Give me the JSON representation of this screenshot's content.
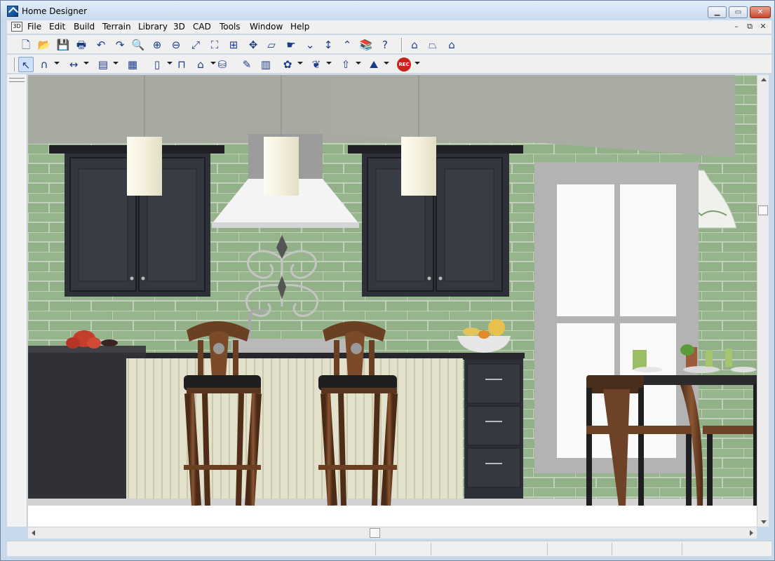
{
  "window": {
    "title": "Home Designer"
  },
  "menu": [
    "File",
    "Edit",
    "Build",
    "Terrain",
    "Library",
    "3D",
    "CAD",
    "Tools",
    "Window",
    "Help"
  ],
  "toolbar1": [
    {
      "name": "new-icon",
      "glyph": "🗋"
    },
    {
      "name": "open-folder-icon",
      "glyph": "📂"
    },
    {
      "name": "save-icon",
      "glyph": "💾"
    },
    {
      "name": "print-icon",
      "glyph": "🖶"
    },
    {
      "name": "undo-icon",
      "glyph": "↶"
    },
    {
      "name": "redo-icon",
      "glyph": "↷"
    },
    {
      "name": "zoom-icon",
      "glyph": "🔍"
    },
    {
      "name": "zoom-in-icon",
      "glyph": "⊕"
    },
    {
      "name": "zoom-out-icon",
      "glyph": "⊖"
    },
    {
      "name": "zoom-box-icon",
      "glyph": "⤢"
    },
    {
      "name": "fill-window-icon",
      "glyph": "⛶"
    },
    {
      "name": "fit-all-icon",
      "glyph": "⊞"
    },
    {
      "name": "pan-icon",
      "glyph": "✥"
    },
    {
      "name": "layer-icon",
      "glyph": "▱"
    },
    {
      "name": "hand-icon",
      "glyph": "☛"
    },
    {
      "name": "down-chevron-icon",
      "glyph": "⌄"
    },
    {
      "name": "height-icon",
      "glyph": "↕"
    },
    {
      "name": "up-chevron-icon",
      "glyph": "⌃"
    },
    {
      "name": "library-books-icon",
      "glyph": "📚"
    },
    {
      "name": "help-icon",
      "glyph": "?"
    },
    {
      "name": "camera-view-icon",
      "glyph": "⌂"
    },
    {
      "name": "overview-icon",
      "glyph": "⏢"
    },
    {
      "name": "floor-plan-icon",
      "glyph": "⌂"
    }
  ],
  "toolbar2": [
    {
      "name": "select-pointer-icon",
      "glyph": "↖"
    },
    {
      "name": "draw-wall-icon",
      "glyph": "∩"
    },
    {
      "name": "dimension-icon",
      "glyph": "↔"
    },
    {
      "name": "cabinet-icon",
      "glyph": "▤"
    },
    {
      "name": "fireplace-icon",
      "glyph": "▦"
    },
    {
      "name": "door-icon",
      "glyph": "▯"
    },
    {
      "name": "stairs-icon",
      "glyph": "⊓"
    },
    {
      "name": "roof-icon",
      "glyph": "⌂"
    },
    {
      "name": "paint-bucket-icon",
      "glyph": "⛁"
    },
    {
      "name": "eyedropper-icon",
      "glyph": "✎"
    },
    {
      "name": "material-icon",
      "glyph": "▥"
    },
    {
      "name": "fixture-icon",
      "glyph": "✿"
    },
    {
      "name": "plant-icon",
      "glyph": "❦"
    },
    {
      "name": "arrow-up-icon",
      "glyph": "⇧"
    },
    {
      "name": "terrain-icon",
      "glyph": "⛰"
    },
    {
      "name": "record-icon",
      "glyph": "REC"
    }
  ],
  "colors": {
    "wall_green": "#8fae85",
    "cabinet": "#2e3038",
    "ceiling": "#a7aaa1",
    "wood": "#5f3a22"
  }
}
